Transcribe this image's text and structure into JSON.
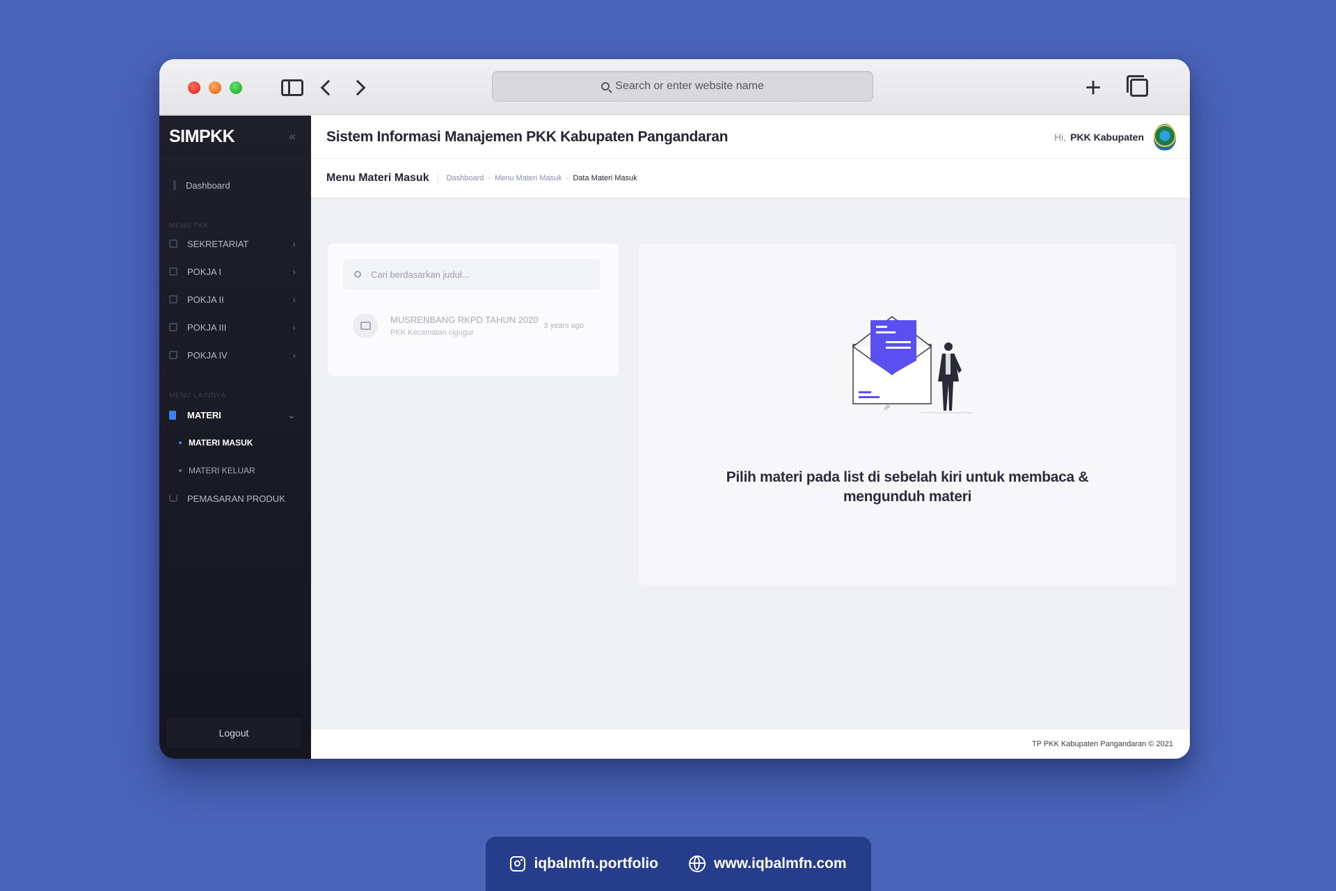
{
  "browser": {
    "url_placeholder": "Search or enter website name"
  },
  "sidebar": {
    "brand": "SIMPKK",
    "dashboard": "Dashboard",
    "section_pkk": "MENU PKK",
    "items_pkk": [
      {
        "label": "SEKRETARIAT"
      },
      {
        "label": "POKJA I"
      },
      {
        "label": "POKJA II"
      },
      {
        "label": "POKJA III"
      },
      {
        "label": "POKJA IV"
      }
    ],
    "section_other": "MENU LAINNYA",
    "materi": "MATERI",
    "materi_masuk": "MATERI MASUK",
    "materi_keluar": "MATERI KELUAR",
    "pemasaran": "PEMASARAN PRODUK",
    "logout": "Logout"
  },
  "header": {
    "title": "Sistem Informasi Manajemen PKK Kabupaten Pangandaran",
    "greeting": "Hi,",
    "username": "PKK Kabupaten"
  },
  "subheader": {
    "page_title": "Menu Materi Masuk",
    "breadcrumb": [
      "Dashboard",
      "Menu Materi Masuk",
      "Data Materi Masuk"
    ]
  },
  "list": {
    "search_placeholder": "Cari berdasarkan judul...",
    "rows": [
      {
        "title": "MUSRENBANG RKPD TAHUN 2020",
        "subtitle": "PKK Kecamatan cigugur",
        "time": "3 years ago"
      }
    ]
  },
  "detail": {
    "empty_message": "Pilih materi pada list di sebelah kiri untuk membaca & mengunduh materi"
  },
  "footer": {
    "text": "TP PKK Kabupaten Pangandaran © 2021"
  },
  "portfolio": {
    "instagram": "iqbalmfn.portfolio",
    "website": "www.iqbalmfn.com"
  },
  "colors": {
    "background": "#4a64b8",
    "sidebar": "#1f1f2b",
    "accent": "#3b82f6",
    "illustration": "#5a4ff0",
    "portfolio_bar": "#263d8c"
  }
}
